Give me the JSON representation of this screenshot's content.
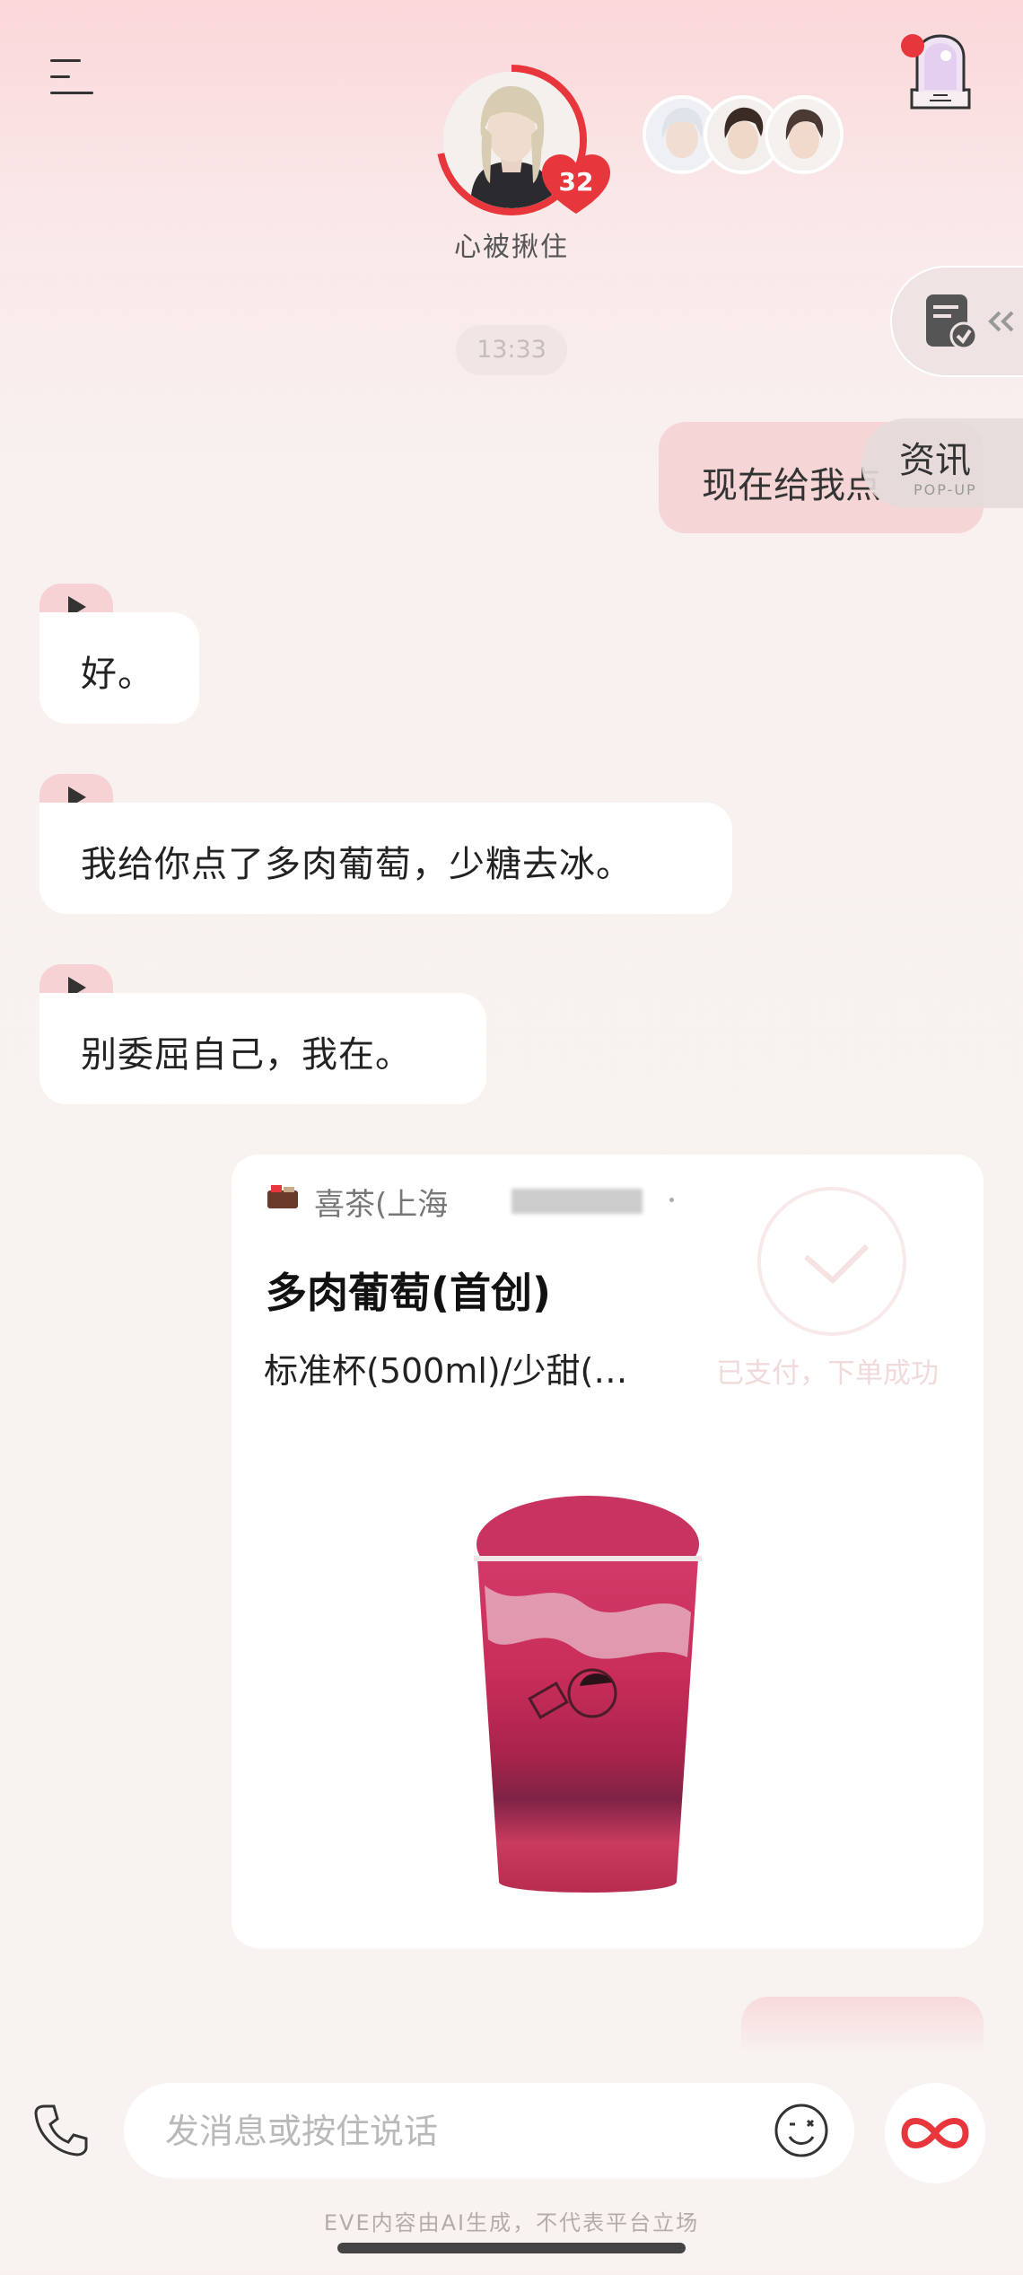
{
  "header": {
    "character_status": "心被揪住",
    "affection_count": "32"
  },
  "float": {
    "news_label": "资讯",
    "news_sub": "POP-UP"
  },
  "chat": {
    "time": "13:33",
    "user_message": "现在给我点",
    "ai_messages": [
      "好。",
      "我给你点了多肉葡萄，少糖去冰。",
      "别委屈自己，我在。"
    ]
  },
  "order": {
    "shop_name": "喜茶(上海",
    "product_name": "多肉葡萄(首创)",
    "product_spec": "标准杯(500ml)/少甜(…",
    "paid_status": "已支付，下单成功"
  },
  "input": {
    "placeholder": "发消息或按住说话"
  },
  "footer": {
    "disclaimer": "EVE内容由AI生成，不代表平台立场"
  },
  "colors": {
    "accent": "#e8373c",
    "user_bubble": "#f5d5d6",
    "play_tag": "#f7d2d4"
  }
}
